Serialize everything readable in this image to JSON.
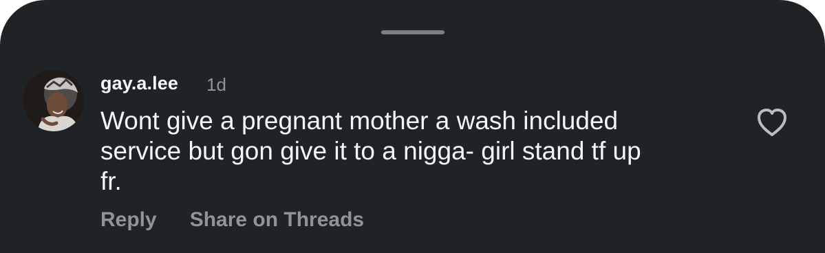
{
  "comment": {
    "username": "gay.a.lee",
    "time": "1d",
    "text_lines": [
      "Wont give a pregnant mother a wash included",
      "service but gon give it to a nigga- girl stand tf up",
      "fr."
    ],
    "actions": {
      "reply": "Reply",
      "share": "Share on Threads"
    }
  },
  "icons": {
    "like": "heart-outline-icon",
    "avatar": "user-avatar"
  },
  "colors": {
    "background": "#202326",
    "primary_text": "#f4f5f6",
    "secondary_text": "#8f949a",
    "grabber": "#7b8087"
  }
}
